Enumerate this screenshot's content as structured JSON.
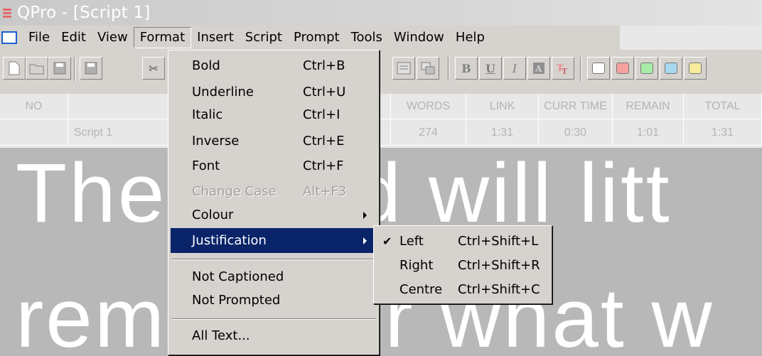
{
  "window": {
    "title": "QPro - [Script 1]"
  },
  "menubar": {
    "items": [
      "File",
      "Edit",
      "View",
      "Format",
      "Insert",
      "Script",
      "Prompt",
      "Tools",
      "Window",
      "Help"
    ],
    "active": "Format"
  },
  "toolbar": {
    "bold_label": "B",
    "underline_label": "U",
    "italic_label": "I",
    "inverse_icon": "inverse-text-icon",
    "font_icon": "font-color-icon",
    "swatches": [
      "#ffffff",
      "#f6a0a0",
      "#a8eaa8",
      "#a8d8f0",
      "#f8ec9c"
    ]
  },
  "grid": {
    "headers": {
      "no": "NO",
      "words": "WORDS",
      "link": "LINK",
      "curr_time": "CURR TIME",
      "remain": "REMAIN",
      "total": "TOTAL"
    },
    "row": {
      "name": "Script 1",
      "words": "274",
      "link": "1:31",
      "curr_time": "0:30",
      "remain": "1:01",
      "total": "1:31"
    }
  },
  "editor": {
    "line1": "The world will litt",
    "line2": "remember what w"
  },
  "format_menu": {
    "items": [
      {
        "label": "Bold",
        "shortcut": "Ctrl+B"
      },
      {
        "label": "Underline",
        "shortcut": "Ctrl+U"
      },
      {
        "label": "Italic",
        "shortcut": "Ctrl+I"
      },
      {
        "label": "Inverse",
        "shortcut": "Ctrl+E"
      },
      {
        "label": "Font",
        "shortcut": "Ctrl+F"
      },
      {
        "label": "Change Case",
        "shortcut": "Alt+F3",
        "disabled": true
      },
      {
        "label": "Colour",
        "submenu": true
      },
      {
        "label": "Justification",
        "submenu": true,
        "highlighted": true
      },
      {
        "label": "Not Captioned"
      },
      {
        "label": "Not Prompted"
      },
      {
        "label": "All Text..."
      }
    ]
  },
  "justification_menu": {
    "items": [
      {
        "label": "Left",
        "shortcut": "Ctrl+Shift+L",
        "checked": true,
        "check_glyph": "✔"
      },
      {
        "label": "Right",
        "shortcut": "Ctrl+Shift+R"
      },
      {
        "label": "Centre",
        "shortcut": "Ctrl+Shift+C"
      }
    ]
  }
}
